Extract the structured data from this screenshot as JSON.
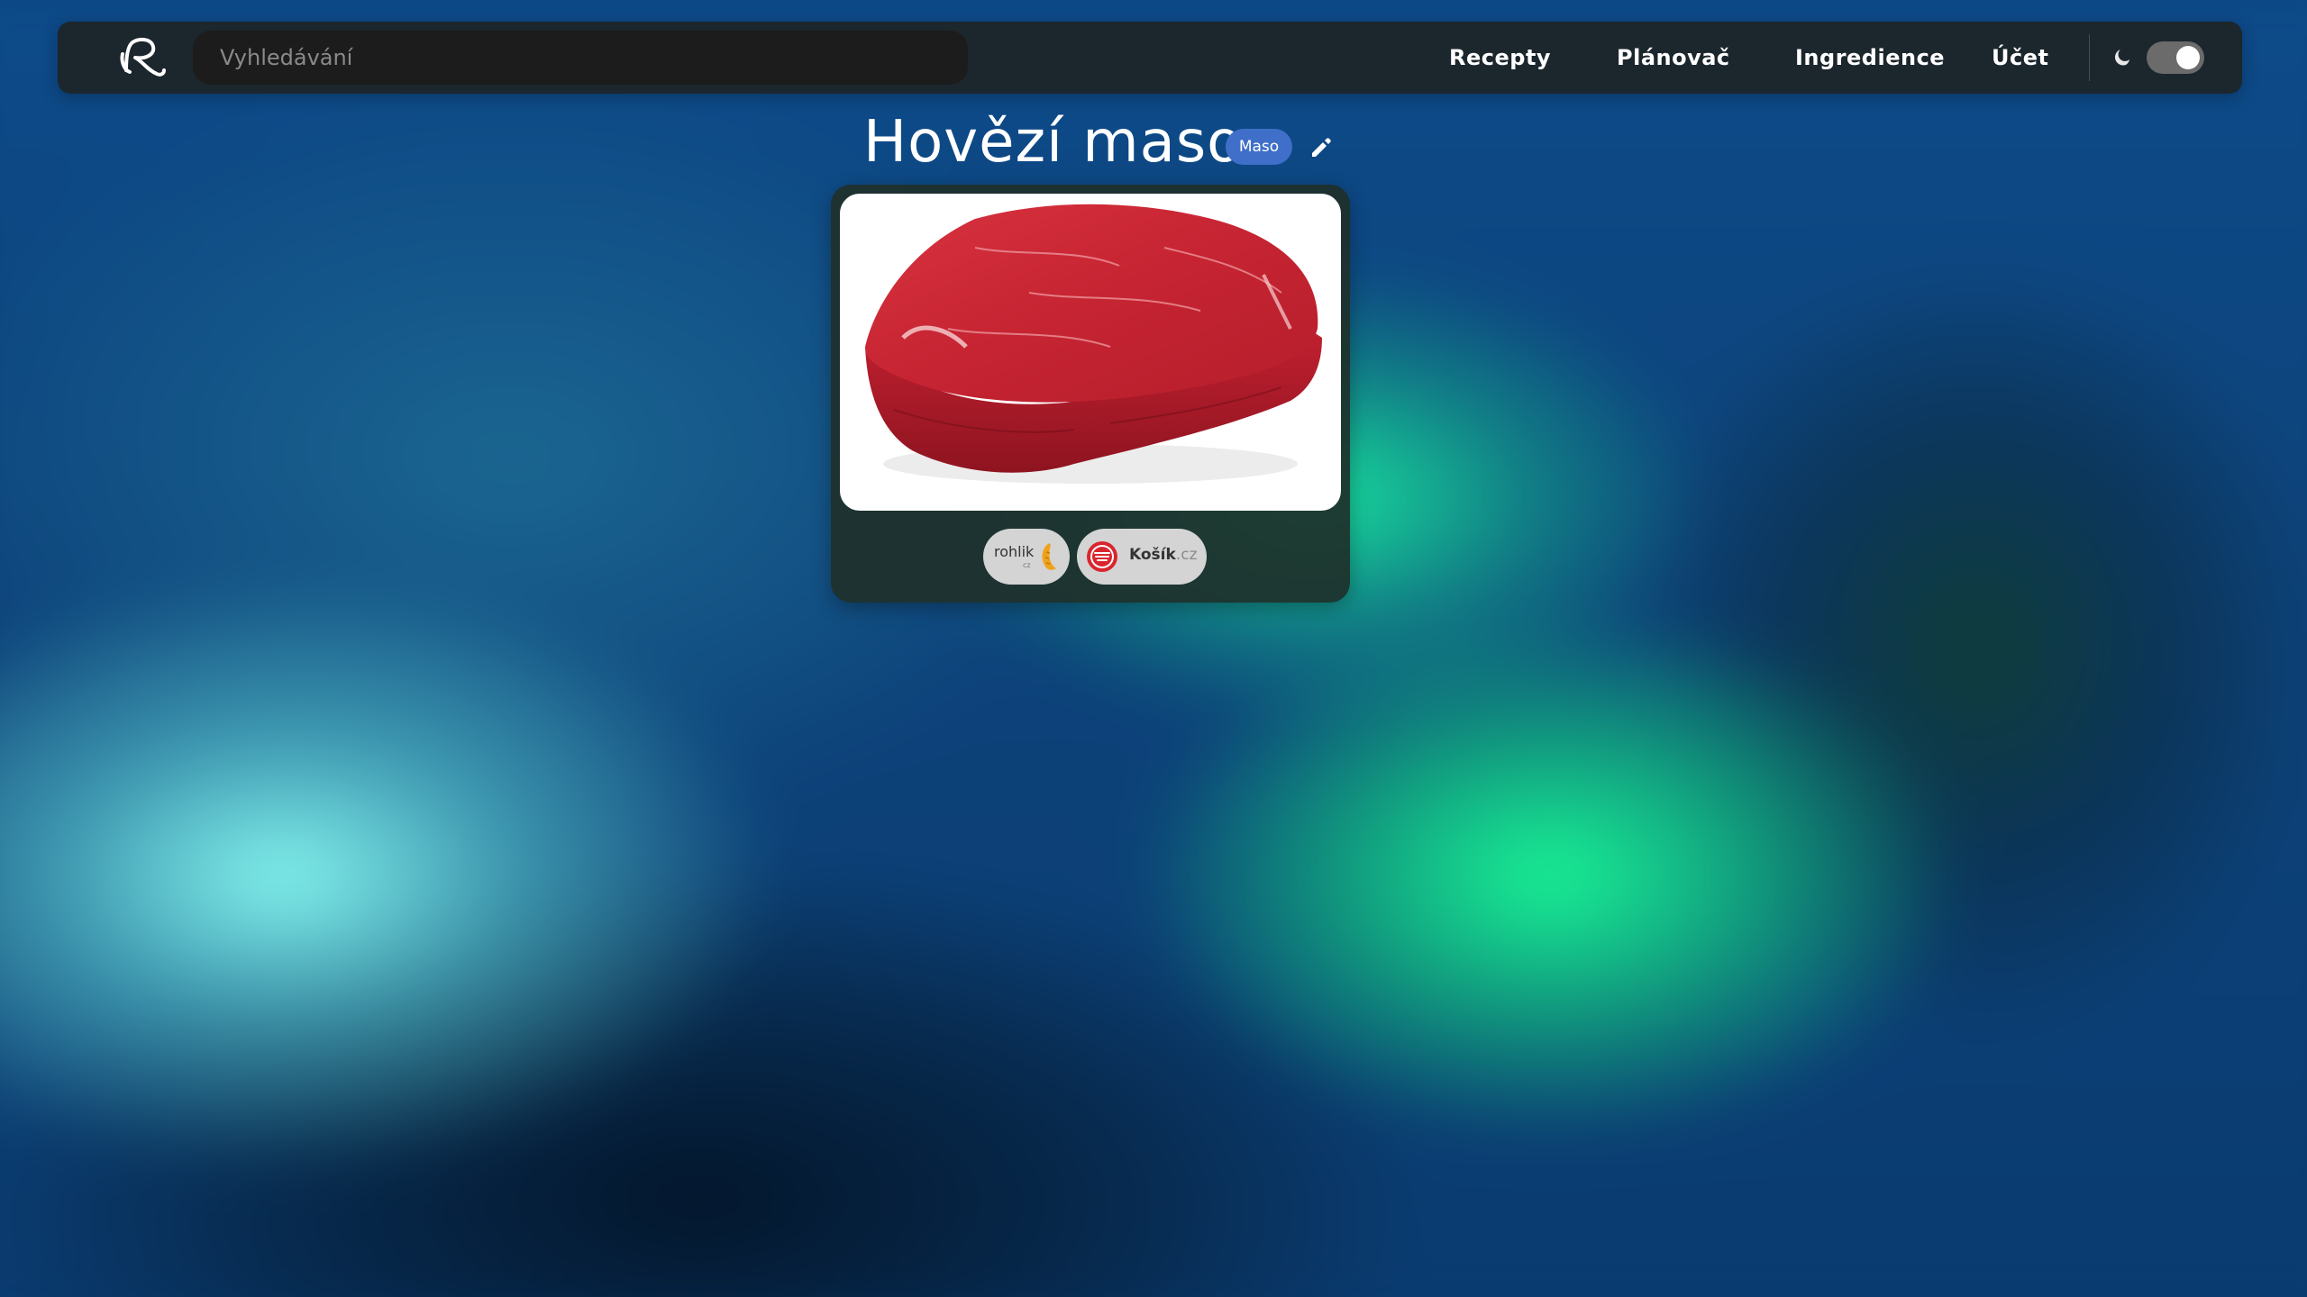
{
  "navbar": {
    "logo_icon": "cursive-r-logo-icon",
    "search_placeholder": "Vyhledávání",
    "links": {
      "recepty": "Recepty",
      "planovac": "Plánovač",
      "ingredience": "Ingredience",
      "ucet": "Účet"
    },
    "theme_icon": "moon-icon",
    "dark_mode_on": true
  },
  "ingredient": {
    "name": "Hovězí maso",
    "category": "Maso",
    "edit_icon": "pencil-icon",
    "image": "raw-beef-steak-image",
    "shops": [
      {
        "name": "rohlik",
        "suffix": "cz",
        "icon": "croissant-icon"
      },
      {
        "name": "Košík",
        "suffix": ".cz",
        "icon": "kosik-basket-icon",
        "color": "#d9262e"
      }
    ]
  },
  "colors": {
    "tag_background": "#3f6fc8",
    "navbar_background": "#1e2426",
    "kosik_red": "#d9262e"
  }
}
